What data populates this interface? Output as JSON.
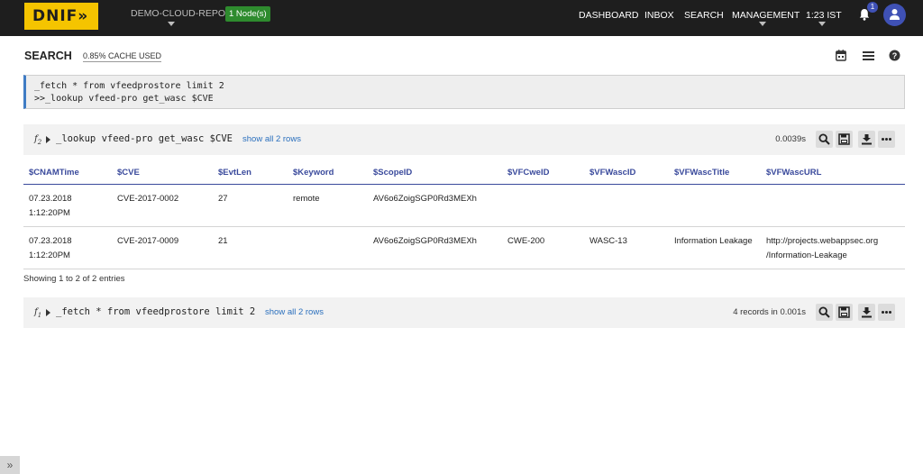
{
  "topbar": {
    "logo": "DNIF»",
    "repo": "DEMO-CLOUD-REPO",
    "nodes_badge": "1 Node(s)",
    "nav": [
      "DASHBOARD",
      "INBOX",
      "SEARCH",
      "MANAGEMENT",
      "1:23 IST"
    ],
    "notification_count": "1",
    "accent_color": "#3f51b5",
    "logo_color": "#f5c400"
  },
  "search": {
    "title": "SEARCH",
    "cache_used": "0.85% CACHE USED",
    "query_lines": [
      "_fetch * from vfeedprostore limit 2",
      ">>_lookup vfeed-pro get_wasc $CVE"
    ]
  },
  "results": [
    {
      "fn": "f",
      "fn_index": "2",
      "query": "_lookup vfeed-pro get_wasc $CVE",
      "show_link": "show all 2 rows",
      "timing": "0.0039s"
    },
    {
      "fn": "f",
      "fn_index": "1",
      "query": "_fetch * from vfeedprostore limit 2",
      "show_link": "show all 2 rows",
      "timing": "4 records in 0.001s"
    }
  ],
  "table": {
    "columns": [
      "$CNAMTime",
      "$CVE",
      "$EvtLen",
      "$Keyword",
      "$ScopeID",
      "$VFCweID",
      "$VFWascID",
      "$VFWascTitle",
      "$VFWascURL"
    ],
    "rows": [
      [
        "07.23.2018 1:12:20PM",
        "CVE-2017-0002",
        "27",
        "remote",
        "AV6o6ZoigSGP0Rd3MEXh",
        "",
        "",
        "",
        ""
      ],
      [
        "07.23.2018 1:12:20PM",
        "CVE-2017-0009",
        "21",
        "",
        "AV6o6ZoigSGP0Rd3MEXh",
        "CWE-200",
        "WASC-13",
        "Information Leakage",
        "http://projects.webappsec.org /Information-Leakage"
      ]
    ],
    "showing": "Showing 1 to 2 of 2 entries"
  },
  "footer": {
    "expand_glyph": "»"
  }
}
